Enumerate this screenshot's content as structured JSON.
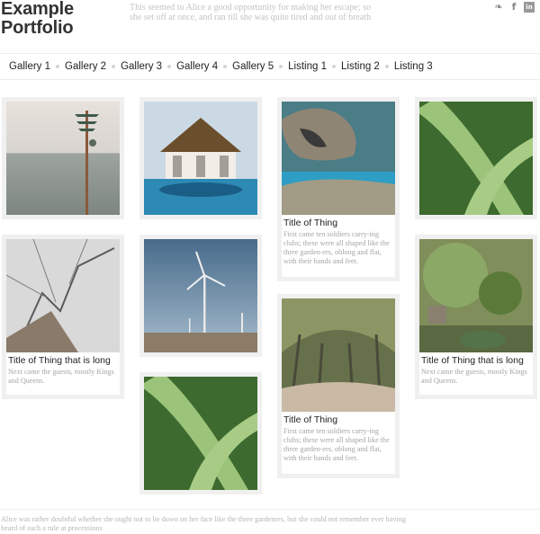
{
  "site": {
    "title_line1": "Example",
    "title_line2": "Portfolio",
    "tagline": "This seemed to Alice a good opportunity for making her escape; so she set off at once, and ran till she was quite tired and out of breath"
  },
  "social": {
    "icons": [
      "twitter-icon",
      "facebook-icon",
      "linkedin-icon"
    ],
    "glyphs": [
      "❧",
      "f",
      "in"
    ]
  },
  "nav": {
    "items": [
      "Gallery 1",
      "Gallery 2",
      "Gallery 3",
      "Gallery 4",
      "Gallery 5",
      "Listing 1",
      "Listing 2",
      "Listing 3"
    ]
  },
  "tiles": {
    "t3": {
      "title": "Title of Thing",
      "text": "First came ten soldiers carry-ing clubs; these were all shaped like the three garden-ers, oblong and flat, with their hands and feet."
    },
    "t5": {
      "title": "Title of Thing that is long",
      "text": "Next came the guests, mostly Kings and Queens."
    },
    "t7": {
      "title": "Title of Thing",
      "text": "First came ten soldiers carry-ing clubs; these were all shaped like the three garden-ers, oblong and flat, with their hands and feet."
    },
    "t8": {
      "title": "Title of Thing that is long",
      "text": "Next came the guests, mostly Kings and Queens."
    }
  },
  "footer": {
    "text": "Alice was rather doubtful whether she ought not to lie down on her face like the three gardeners, but she could not remember ever having heard of such a rule at processions"
  },
  "colors": {
    "tile_border": "#f0f0f0",
    "caption_text": "#a5a5a5",
    "title_text": "#222222"
  }
}
